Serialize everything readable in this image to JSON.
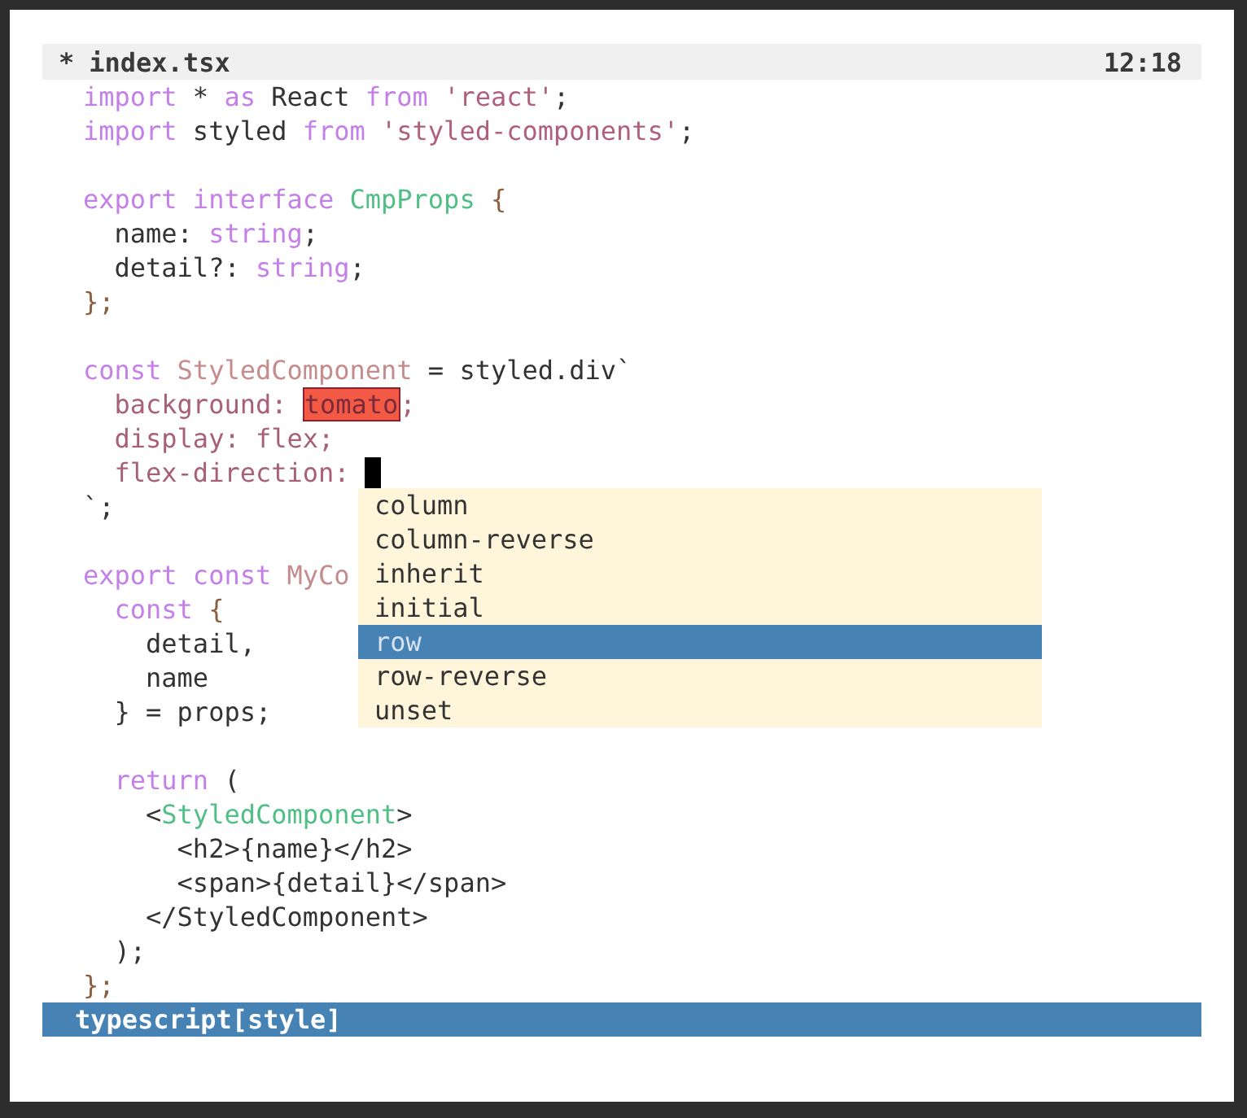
{
  "title_bar": {
    "modified_mark": "*",
    "filename": "index.tsx",
    "clock": "12:18"
  },
  "code_lines": [
    {
      "cursor": false,
      "tokens": [
        {
          "kind": "keyword",
          "text": "import"
        },
        {
          "kind": "plain",
          "text": " * "
        },
        {
          "kind": "keyword",
          "text": "as"
        },
        {
          "kind": "plain",
          "text": " React "
        },
        {
          "kind": "keyword",
          "text": "from"
        },
        {
          "kind": "string",
          "text": " 'react'"
        },
        {
          "kind": "plain",
          "text": ";"
        }
      ]
    },
    {
      "cursor": false,
      "tokens": [
        {
          "kind": "keyword",
          "text": "import"
        },
        {
          "kind": "plain",
          "text": " styled "
        },
        {
          "kind": "keyword",
          "text": "from"
        },
        {
          "kind": "string",
          "text": " 'styled-components'"
        },
        {
          "kind": "plain",
          "text": ";"
        }
      ]
    },
    {
      "cursor": false
    },
    {
      "cursor": false,
      "tokens": [
        {
          "kind": "keyword",
          "text": "export"
        },
        {
          "kind": "keyword",
          "text": " interface"
        },
        {
          "kind": "type",
          "text": " CmpProps"
        },
        {
          "kind": "punct",
          "text": " {"
        }
      ]
    },
    {
      "cursor": false,
      "tokens": [
        {
          "kind": "plain",
          "text": "  name: "
        },
        {
          "kind": "keyword",
          "text": "string"
        },
        {
          "kind": "plain",
          "text": ";"
        }
      ]
    },
    {
      "cursor": false,
      "tokens": [
        {
          "kind": "plain",
          "text": "  detail?: "
        },
        {
          "kind": "keyword",
          "text": "string"
        },
        {
          "kind": "plain",
          "text": ";"
        }
      ]
    },
    {
      "cursor": false,
      "tokens": [
        {
          "kind": "punct",
          "text": "};"
        }
      ]
    },
    {
      "cursor": false
    },
    {
      "cursor": false,
      "tokens": [
        {
          "kind": "keyword",
          "text": "const"
        },
        {
          "kind": "definition",
          "text": " StyledComponent"
        },
        {
          "kind": "plain",
          "text": " = styled.div`"
        }
      ]
    },
    {
      "cursor": false,
      "tokens": [
        {
          "kind": "css",
          "text": "  background: "
        },
        {
          "kind": "swatch",
          "text": "tomato"
        },
        {
          "kind": "css",
          "text": ";"
        }
      ]
    },
    {
      "cursor": false,
      "tokens": [
        {
          "kind": "css",
          "text": "  display: flex;"
        }
      ]
    },
    {
      "cursor": true,
      "tokens": [
        {
          "kind": "css",
          "text": "  flex-direction: "
        }
      ]
    },
    {
      "cursor": false,
      "tokens": [
        {
          "kind": "plain",
          "text": "`;"
        }
      ]
    },
    {
      "cursor": false
    },
    {
      "cursor": false,
      "tokens": [
        {
          "kind": "keyword",
          "text": "export const"
        },
        {
          "kind": "definition",
          "text": " MyCo"
        }
      ]
    },
    {
      "cursor": false,
      "tokens": [
        {
          "kind": "keyword",
          "text": "  const"
        },
        {
          "kind": "punct",
          "text": " {"
        }
      ]
    },
    {
      "cursor": false,
      "tokens": [
        {
          "kind": "plain",
          "text": "    detail,"
        }
      ]
    },
    {
      "cursor": false,
      "tokens": [
        {
          "kind": "plain",
          "text": "    name"
        }
      ]
    },
    {
      "cursor": false,
      "tokens": [
        {
          "kind": "plain",
          "text": "  } = props;"
        }
      ]
    },
    {
      "cursor": false
    },
    {
      "cursor": false,
      "tokens": [
        {
          "kind": "keyword",
          "text": "  return"
        },
        {
          "kind": "plain",
          "text": " ("
        }
      ]
    },
    {
      "cursor": false,
      "tokens": [
        {
          "kind": "plain",
          "text": "    <"
        },
        {
          "kind": "type",
          "text": "StyledComponent"
        },
        {
          "kind": "plain",
          "text": ">"
        }
      ]
    },
    {
      "cursor": false,
      "tokens": [
        {
          "kind": "plain",
          "text": "      <h2>{name}</h2>"
        }
      ]
    },
    {
      "cursor": false,
      "tokens": [
        {
          "kind": "plain",
          "text": "      <span>{detail}</span>"
        }
      ]
    },
    {
      "cursor": false,
      "tokens": [
        {
          "kind": "plain",
          "text": "    </StyledComponent>"
        }
      ]
    },
    {
      "cursor": false,
      "tokens": [
        {
          "kind": "plain",
          "text": "  );"
        }
      ]
    },
    {
      "cursor": false,
      "tokens": [
        {
          "kind": "punct",
          "text": "};"
        }
      ]
    }
  ],
  "completion_popup": {
    "items": [
      {
        "label": "column",
        "selected": false
      },
      {
        "label": "column-reverse",
        "selected": false
      },
      {
        "label": "inherit",
        "selected": false
      },
      {
        "label": "initial",
        "selected": false
      },
      {
        "label": "row",
        "selected": true
      },
      {
        "label": "row-reverse",
        "selected": false
      },
      {
        "label": "unset",
        "selected": false
      }
    ]
  },
  "status_bar": {
    "mode": "typescript[style]"
  }
}
